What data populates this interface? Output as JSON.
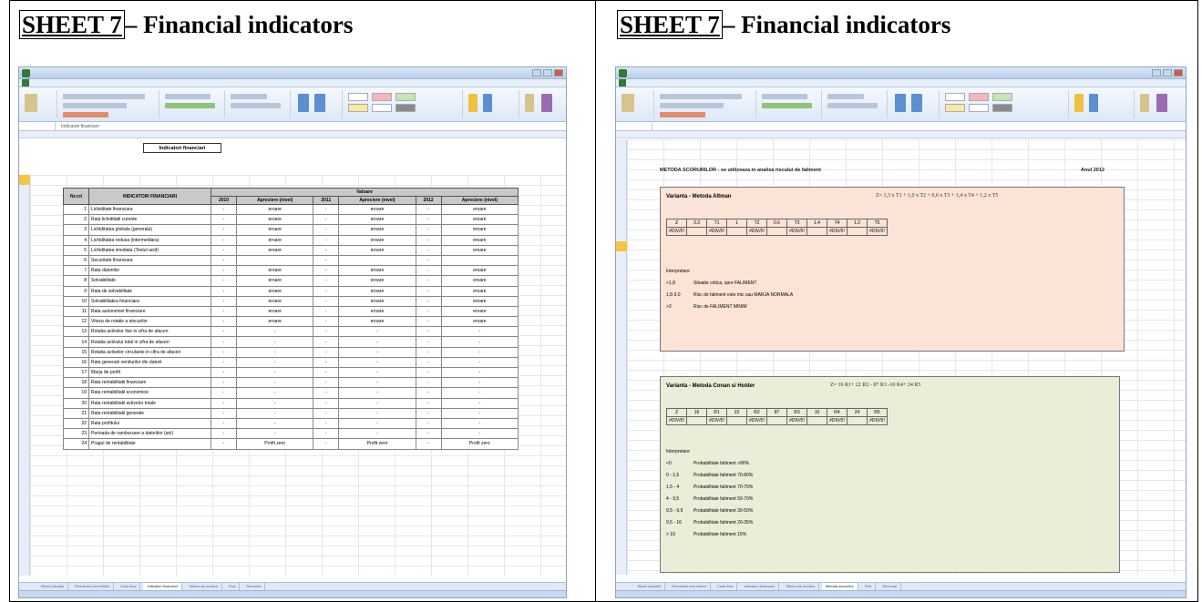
{
  "headings": {
    "left": {
      "sheet": "SHEET 7",
      "rest": "– Financial indicators"
    },
    "right": {
      "sheet": "SHEET 7",
      "rest": "– Financial indicators"
    }
  },
  "left_window": {
    "indicator_title": "Indicatori financiari",
    "header": {
      "nr": "Nr.crt",
      "indicator": "INDICATORI FINANCIARI",
      "values": "Valoare",
      "y2010": "2010",
      "y2011": "2011",
      "y2012": "2012",
      "apr": "Apreciere (nivel)"
    },
    "rows": [
      {
        "nr": "1",
        "name": "Lichiditate financiara",
        "v": "eroare"
      },
      {
        "nr": "2",
        "name": "Rata lichiditatii curente",
        "v": "eroare"
      },
      {
        "nr": "3",
        "name": "Lichiditatea globala (generala)",
        "v": "eroare"
      },
      {
        "nr": "4",
        "name": "Lichiditatea redusa (intermediara)",
        "v": "eroare"
      },
      {
        "nr": "5",
        "name": "Lichiditatea imediata (Testul acid)",
        "v": "eroare"
      },
      {
        "nr": "6",
        "name": "Securitate financiara",
        "v": ""
      },
      {
        "nr": "7",
        "name": "Rata datoriilor",
        "v": "eroare"
      },
      {
        "nr": "8",
        "name": "Solvabilitate",
        "v": "eroare"
      },
      {
        "nr": "9",
        "name": "Rata de solvabilitate",
        "v": "eroare"
      },
      {
        "nr": "10",
        "name": "Solvabilitatea financiara",
        "v": "eroare"
      },
      {
        "nr": "11",
        "name": "Rata autonomiei financiare",
        "v": "eroare"
      },
      {
        "nr": "12",
        "name": "Viteza de rotatie a stocurilor",
        "v": "eroare"
      },
      {
        "nr": "13",
        "name": "Rotatia activelor fixe in cifra de afaceri",
        "v": "-"
      },
      {
        "nr": "14",
        "name": "Rotatia activului total in cifra de afaceri",
        "v": "-"
      },
      {
        "nr": "15",
        "name": "Rotatia activelor circulante in cifra de afaceri",
        "v": "-"
      },
      {
        "nr": "16",
        "name": "Rata generarii veniturilor din datorii",
        "v": "-"
      },
      {
        "nr": "17",
        "name": "Marja de profit",
        "v": "-"
      },
      {
        "nr": "18",
        "name": "Rata rentabilitatii financiare",
        "v": "-"
      },
      {
        "nr": "19",
        "name": "Rata rentabilitatii economice",
        "v": "-"
      },
      {
        "nr": "20",
        "name": "Rata rentabilitatii activelor totale",
        "v": "-"
      },
      {
        "nr": "21",
        "name": "Rata rentabilitatii generale",
        "v": "-"
      },
      {
        "nr": "22",
        "name": "Rata profitului",
        "v": "-"
      },
      {
        "nr": "23",
        "name": "Perioada de rambursare a datoriilor (ani)",
        "v": "-"
      },
      {
        "nr": "24",
        "name": "Pragul de rentabilitate",
        "v": "Profit zero"
      }
    ],
    "tabs": [
      "Bilant (situatii)",
      "Rezultatul exercitiului",
      "Cash flow",
      "Indicatori financiari",
      "Tabelul de analiza",
      "Fisa",
      "Rezumat"
    ]
  },
  "right_window": {
    "method_title": "METODA SCORURILOR - se utilizeaza in analiza riscului de faliment",
    "year": "Anul 2012",
    "altman": {
      "title": "Varianta - Metoda Altman",
      "formula": "Z= 3,3 x T1 + 1,0 x T2 + 0,6 x T3 + 1,4 x T4 + 1,2 x T5",
      "head": [
        "Z",
        "3.3",
        "T1",
        "1",
        "T2",
        "0.6",
        "T3",
        "1.4",
        "T4",
        "1.2",
        "T5"
      ],
      "vals": [
        "#DIV/0!",
        "",
        "#DIV/0!",
        "",
        "#DIV/0!",
        "",
        "#DIV/0!",
        "",
        "#DIV/0!",
        "",
        "#DIV/0!"
      ],
      "interp_label": "Interpretare",
      "interp": [
        {
          "k": "<1,8",
          "t": "Situatie critica, spre FALIMENT"
        },
        {
          "k": "1,8-3,0",
          "t": "Risc de faliment este mic sau MARJA NORMALA"
        },
        {
          "k": ">3",
          "t": "Risc de FALIMENT MINIM"
        }
      ]
    },
    "conan": {
      "title": "Varianta - Metoda Conan si Holder",
      "formula": "Z= 16 R1+ 22 R2 - 87 R3 -10 R4+ 24 R5",
      "head": [
        "Z",
        "16",
        "R1",
        "22",
        "R2",
        "87",
        "R3",
        "10",
        "R4",
        "24",
        "R5"
      ],
      "vals": [
        "#DIV/0!",
        "",
        "#DIV/0!",
        "",
        "#DIV/0!",
        "",
        "#DIV/0!",
        "",
        "#DIV/0!",
        "",
        "#DIV/0!"
      ],
      "interp_label": "Interpretare",
      "interp": [
        {
          "k": "<0",
          "t": "Probabilitate faliment >90%"
        },
        {
          "k": "0 - 1,5",
          "t": "Probabilitate faliment 70-80%"
        },
        {
          "k": "1,5 - 4",
          "t": "Probabilitate faliment 70-75%"
        },
        {
          "k": "4 - 9,5",
          "t": "Probabilitate faliment 50-70%"
        },
        {
          "k": "9,5 - 9,5",
          "t": "Probabilitate faliment 30-50%"
        },
        {
          "k": "9,5 - 16",
          "t": "Probabilitate faliment 20-35%"
        },
        {
          "k": "> 16",
          "t": "Probabilitate faliment 15%"
        }
      ]
    },
    "tabs": [
      "Bilant (situatii)",
      "Rezultatul exercitiului",
      "Cash flow",
      "Indicatori financiari",
      "Tabelul de analiza",
      "Metoda scorurilor",
      "Fisa",
      "Rezumat"
    ]
  },
  "colors": {
    "altman_bg": "#fbe3d6",
    "conan_bg": "#e8eed8",
    "table_header": "#c9c9c9"
  }
}
